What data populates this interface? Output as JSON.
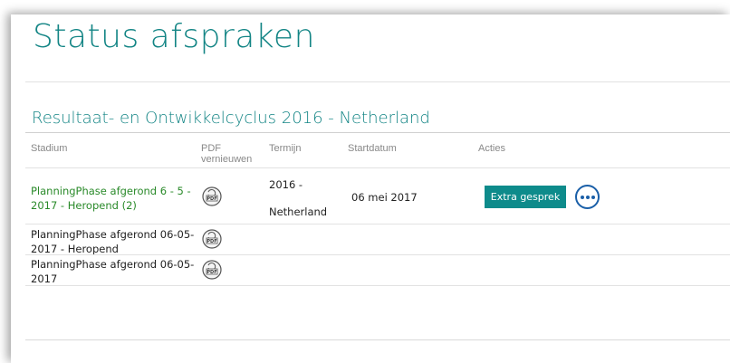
{
  "page": {
    "title": "Status afspraken"
  },
  "section": {
    "title": "Resultaat- en Ontwikkelcyclus 2016 - Netherland"
  },
  "table": {
    "headers": {
      "stadium": "Stadium",
      "pdf_line1": "PDF",
      "pdf_line2": "vernieuwen",
      "termijn": "Termijn",
      "startdatum": "Startdatum",
      "acties": "Acties"
    },
    "rows": [
      {
        "stadium_line1": "PlanningPhase afgerond 6 - 5 -",
        "stadium_line2": "2017 - Heropend (2)",
        "termijn_line1": "2016 -",
        "termijn_line2": "Netherland",
        "startdatum": "06 mei 2017",
        "action_label": "Extra gesprek"
      },
      {
        "stadium_line1": "PlanningPhase afgerond 06-05-",
        "stadium_line2": "2017 - Heropend"
      },
      {
        "stadium_line1": "PlanningPhase afgerond 06-05-",
        "stadium_line2": "2017"
      }
    ]
  },
  "icons": {
    "pdf": "pdf-refresh-icon",
    "more": "more-options-icon"
  },
  "colors": {
    "accent": "#138585",
    "button": "#0e8b8b",
    "link_green": "#2a8a2a",
    "more_blue": "#1a5fa8"
  }
}
